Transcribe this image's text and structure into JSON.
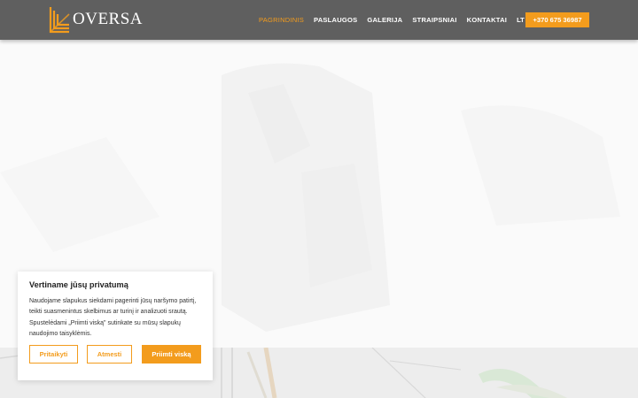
{
  "colors": {
    "accent": "#f39c1d",
    "header_bg": "#5f5f5f"
  },
  "brand": {
    "name": "OVERSA",
    "logo_icon": "oversa-logo-icon"
  },
  "nav": {
    "items": [
      {
        "label": "PAGRINDINIS",
        "active": true
      },
      {
        "label": "PASLAUGOS",
        "active": false
      },
      {
        "label": "GALERIJA",
        "active": false
      },
      {
        "label": "STRAIPSNIAI",
        "active": false
      },
      {
        "label": "KONTAKTAI",
        "active": false
      }
    ],
    "language": {
      "label": "LT",
      "flag_icon": "lithuania-flag-icon",
      "dropdown_icon": "chevron-down-icon"
    }
  },
  "phone": {
    "label": "+370 675 36987"
  },
  "cookie": {
    "title": "Vertiname jūsų privatumą",
    "text": "Naudojame slapukus siekdami pagerinti jūsų naršymo patirtį, teikti suasmenintus skelbimus ar turinį ir analizuoti srautą. Spustelėdami „Priimti viską\" sutinkate su mūsų slapukų naudojimo taisyklėmis.",
    "customize_label": "Pritaikyti",
    "reject_label": "Atmesti",
    "accept_label": "Priimti viską"
  }
}
